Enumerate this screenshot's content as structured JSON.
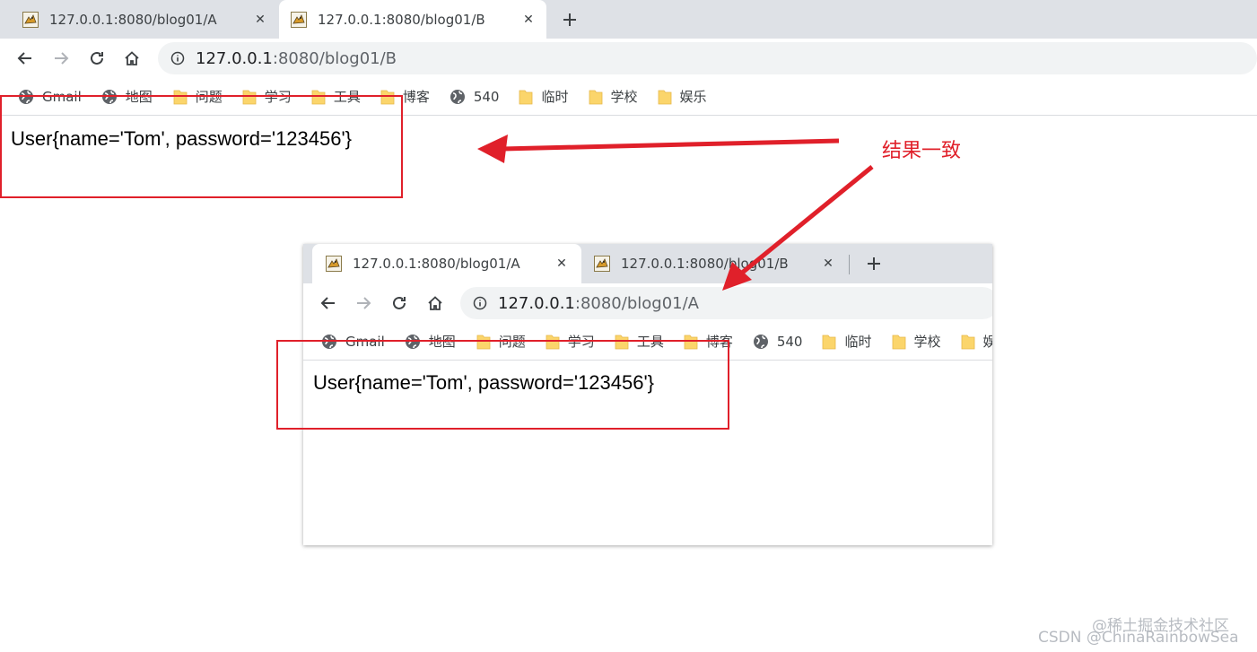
{
  "window1": {
    "tabs": [
      {
        "title": "127.0.0.1:8080/blog01/A",
        "active": false
      },
      {
        "title": "127.0.0.1:8080/blog01/B",
        "active": true
      }
    ],
    "url_host": "127.0.0.1",
    "url_rest": ":8080/blog01/B",
    "content": "User{name='Tom', password='123456'}"
  },
  "window2": {
    "tabs": [
      {
        "title": "127.0.0.1:8080/blog01/A",
        "active": true
      },
      {
        "title": "127.0.0.1:8080/blog01/B",
        "active": false
      }
    ],
    "url_host": "127.0.0.1",
    "url_rest": ":8080/blog01/A",
    "content": "User{name='Tom', password='123456'}"
  },
  "bookmarks": [
    {
      "label": "Gmail",
      "icon": "globe-icon"
    },
    {
      "label": "地图",
      "icon": "globe-icon"
    },
    {
      "label": "问题",
      "icon": "folder-icon"
    },
    {
      "label": "学习",
      "icon": "folder-icon"
    },
    {
      "label": "工具",
      "icon": "folder-icon"
    },
    {
      "label": "博客",
      "icon": "folder-icon"
    },
    {
      "label": "540",
      "icon": "globe-icon"
    },
    {
      "label": "临时",
      "icon": "folder-icon"
    },
    {
      "label": "学校",
      "icon": "folder-icon"
    },
    {
      "label": "娱乐",
      "icon": "folder-icon"
    }
  ],
  "annotation": {
    "note": "结果一致",
    "color": "#e0202a"
  },
  "watermark": {
    "line1": "@稀土掘金技术社区",
    "line2": "CSDN @ChinaRainbowSea"
  }
}
